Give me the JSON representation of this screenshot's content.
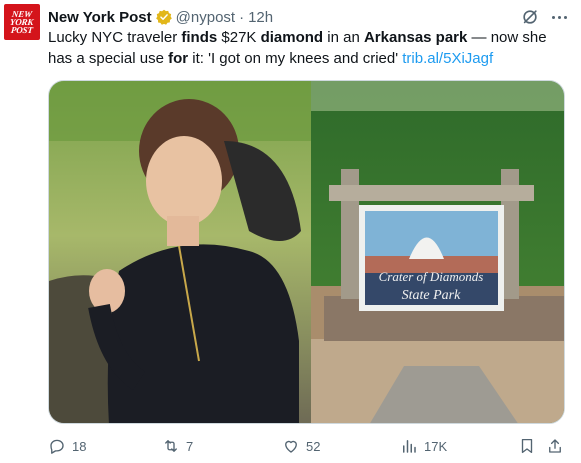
{
  "account": {
    "name": "New York Post",
    "handle": "@nypost",
    "separator": "·",
    "time": "12h",
    "avatar_lines": [
      "NEW",
      "YORK",
      "POST"
    ]
  },
  "tweet": {
    "t1": "Lucky NYC traveler ",
    "t2": "finds",
    "t3": " $27K ",
    "t4": "diamond",
    "t5": " in an ",
    "t6": "Arkansas park",
    "t7": " — now she has a special use ",
    "t8": "for",
    "t9": " it: 'I got on my knees and cried' ",
    "link": "trib.al/5XiJagf"
  },
  "media": {
    "sign_line1": "Crater of Diamonds",
    "sign_line2": "State Park"
  },
  "actions": {
    "replies": "18",
    "reposts": "7",
    "likes": "52",
    "views": "17K"
  },
  "colors": {
    "accent": "#1d9bf0",
    "muted": "#536471",
    "brand": "#d4141b",
    "verified": "#e2b719"
  },
  "icons": [
    "verified-badge-icon",
    "grok-icon",
    "more-icon",
    "reply-icon",
    "repost-icon",
    "like-icon",
    "views-icon",
    "bookmark-icon",
    "share-icon"
  ]
}
